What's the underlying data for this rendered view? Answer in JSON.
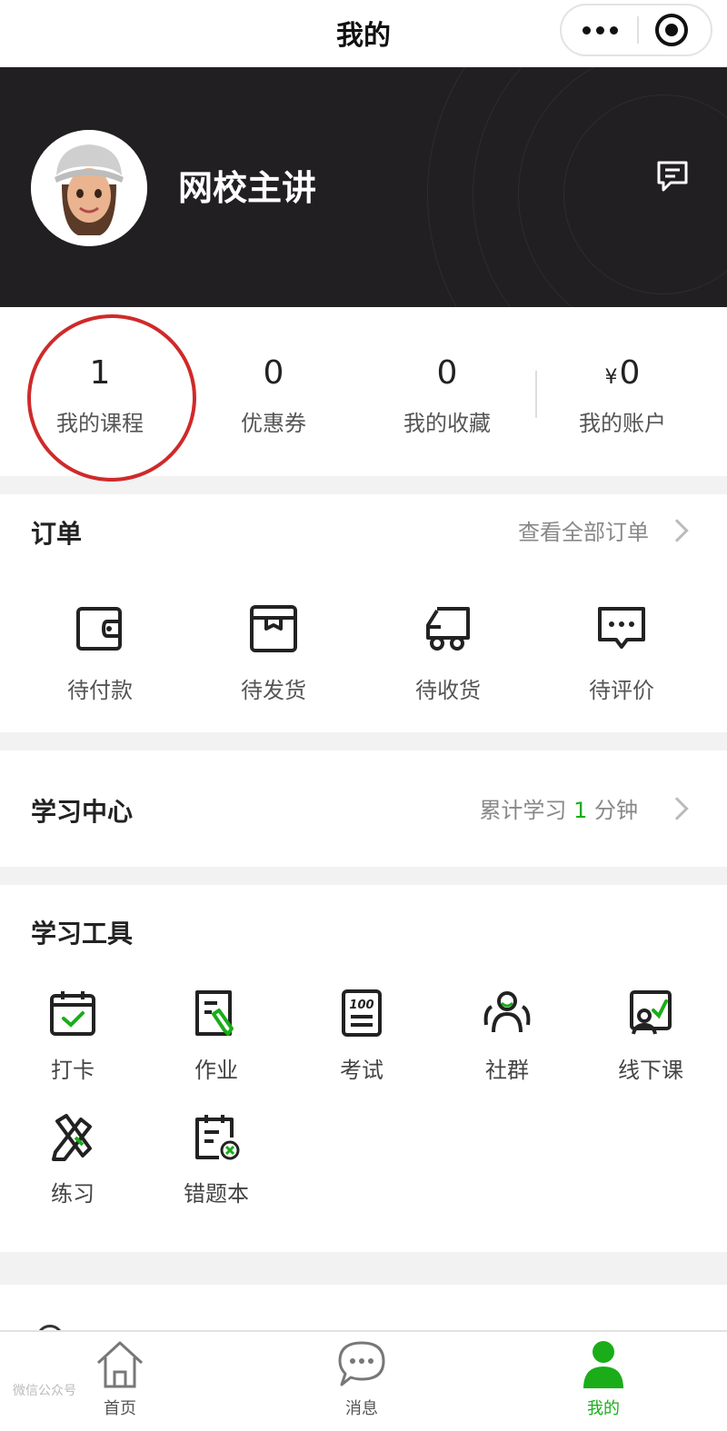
{
  "nav": {
    "title": "我的"
  },
  "profile": {
    "name": "网校主讲"
  },
  "stats": [
    {
      "value": "1",
      "label": "我的课程"
    },
    {
      "value": "0",
      "label": "优惠券"
    },
    {
      "value": "0",
      "label": "我的收藏"
    },
    {
      "currency": "¥",
      "value": "0",
      "label": "我的账户"
    }
  ],
  "orders": {
    "title": "订单",
    "link": "查看全部订单",
    "items": [
      {
        "label": "待付款",
        "icon": "wallet-icon"
      },
      {
        "label": "待发货",
        "icon": "box-icon"
      },
      {
        "label": "待收货",
        "icon": "truck-icon"
      },
      {
        "label": "待评价",
        "icon": "comment-icon"
      }
    ]
  },
  "study_center": {
    "title": "学习中心",
    "prefix": "累计学习",
    "minutes": "1",
    "suffix": "分钟"
  },
  "tools": {
    "title": "学习工具",
    "items": [
      {
        "label": "打卡",
        "icon": "calendar-check-icon"
      },
      {
        "label": "作业",
        "icon": "homework-icon"
      },
      {
        "label": "考试",
        "icon": "exam-icon"
      },
      {
        "label": "社群",
        "icon": "community-icon"
      },
      {
        "label": "线下课",
        "icon": "offline-class-icon"
      },
      {
        "label": "练习",
        "icon": "practice-icon"
      },
      {
        "label": "错题本",
        "icon": "wrong-book-icon"
      }
    ]
  },
  "tabbar": [
    {
      "label": "首页",
      "icon": "home-icon",
      "active": false
    },
    {
      "label": "消息",
      "icon": "chat-icon",
      "active": false
    },
    {
      "label": "我的",
      "icon": "person-icon",
      "active": true
    }
  ],
  "watermark": "微信公众号",
  "colors": {
    "accent": "#1aad19",
    "banner": "#221f23",
    "mark": "#cf2a2a"
  }
}
